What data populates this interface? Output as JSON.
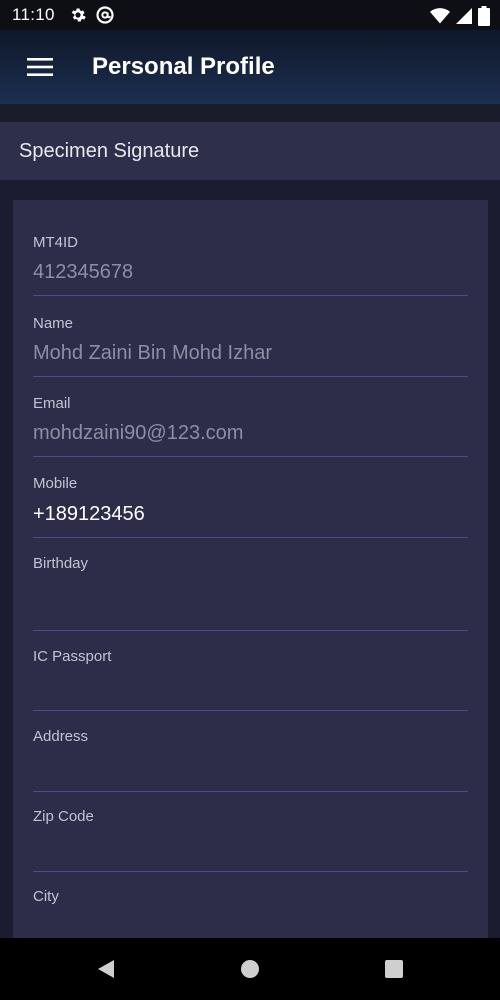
{
  "status_bar": {
    "time": "11:10",
    "icons": [
      "gear-icon",
      "at-sign-icon",
      "wifi-icon",
      "signal-icon",
      "battery-icon"
    ]
  },
  "app_bar": {
    "title": "Personal Profile",
    "menu_icon": "hamburger-menu-icon"
  },
  "section": {
    "title": "Specimen Signature"
  },
  "fields": [
    {
      "label": "MT4ID",
      "value": "412345678"
    },
    {
      "label": "Name",
      "value": "Mohd Zaini Bin Mohd Izhar"
    },
    {
      "label": "Email",
      "value": "mohdzaini90@123.com"
    },
    {
      "label": "Mobile",
      "value": "+189123456"
    },
    {
      "label": "Birthday",
      "value": ""
    },
    {
      "label": "IC Passport",
      "value": ""
    },
    {
      "label": "Address",
      "value": ""
    },
    {
      "label": "Zip Code",
      "value": ""
    },
    {
      "label": "City",
      "value": ""
    }
  ],
  "nav": {
    "icons": [
      "back-icon",
      "home-icon",
      "recents-icon"
    ]
  },
  "colors": {
    "card": "#2d2d49",
    "section_header": "#2e2f4a",
    "underline": "#46527e",
    "muted_value": "#8d8ea3"
  }
}
